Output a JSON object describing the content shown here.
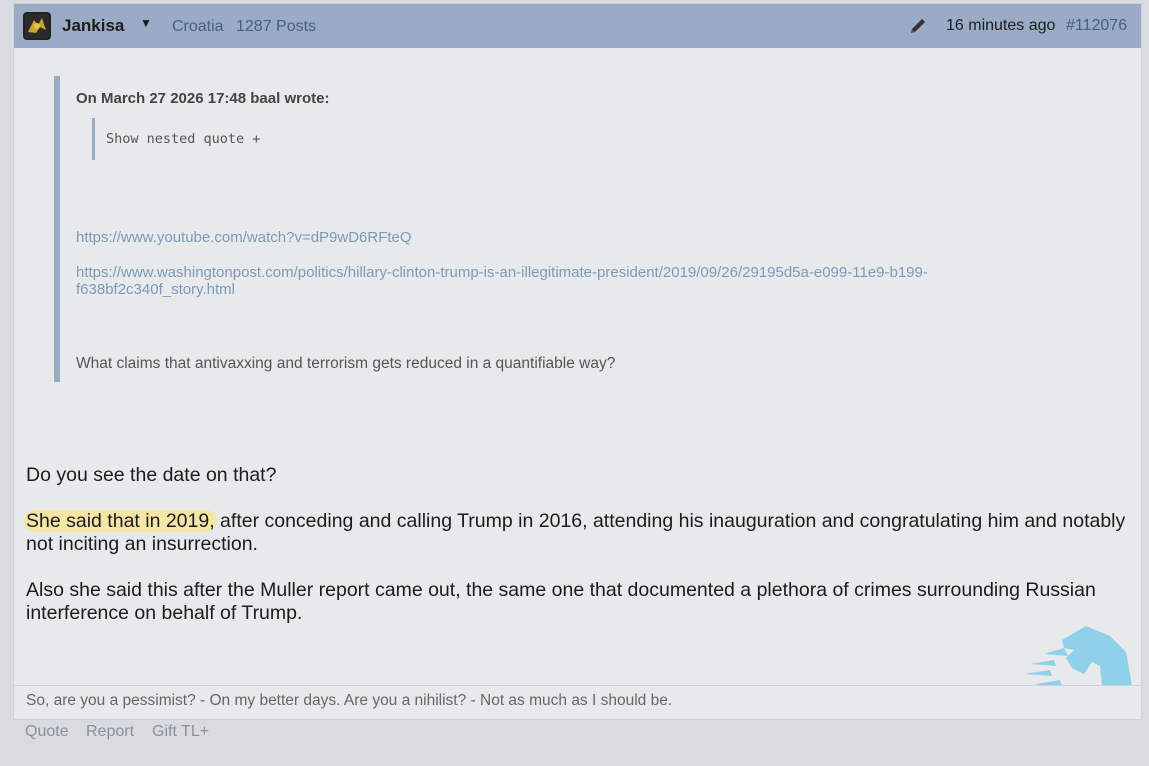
{
  "header": {
    "username": "Jankisa",
    "caret": "▼",
    "country": "Croatia",
    "posts": "1287 Posts",
    "time": "16 minutes ago",
    "post_number": "#112076"
  },
  "quote": {
    "author_line": "On March 27 2026 17:48 baal wrote:",
    "nested_toggle": "Show nested quote +",
    "link1": "https://www.youtube.com/watch?v=dP9wD6RFteQ",
    "link2_line1": "https://www.washingtonpost.com/politics/hillary-clinton-trump-is-an-illegitimate-president/2019/09/26/29195d5a-e099-11e9-b199-",
    "link2_line2": "f638bf2c340f_story.html",
    "text": "What claims that antivaxxing and terrorism gets reduced in a quantifiable way?"
  },
  "body": {
    "p1": "Do you see the date on that?",
    "p2_highlight": "She said that in 2019,",
    "p2_rest": " after conceding and calling Trump in 2016, attending his inauguration and congratulating him and notably not inciting an insurrection.",
    "p3": "Also she said this after the Muller report came out, the same one that documented a plethora of crimes surrounding Russian interference on behalf of Trump."
  },
  "signature": "So, are you a pessimist? - On my better days. Are you a nihilist? - Not as much as I should be.",
  "footer": {
    "quote": "Quote",
    "report": "Report",
    "gift": "Gift TL+"
  },
  "colors": {
    "header_bg": "#9aabc6",
    "link": "#7c9ab8",
    "highlight": "#f6e6a6",
    "logo": "#8fd0ea"
  },
  "icons": [
    "avatar-icon",
    "caret-down-icon",
    "pencil-edit-icon",
    "team-liquid-logo"
  ]
}
